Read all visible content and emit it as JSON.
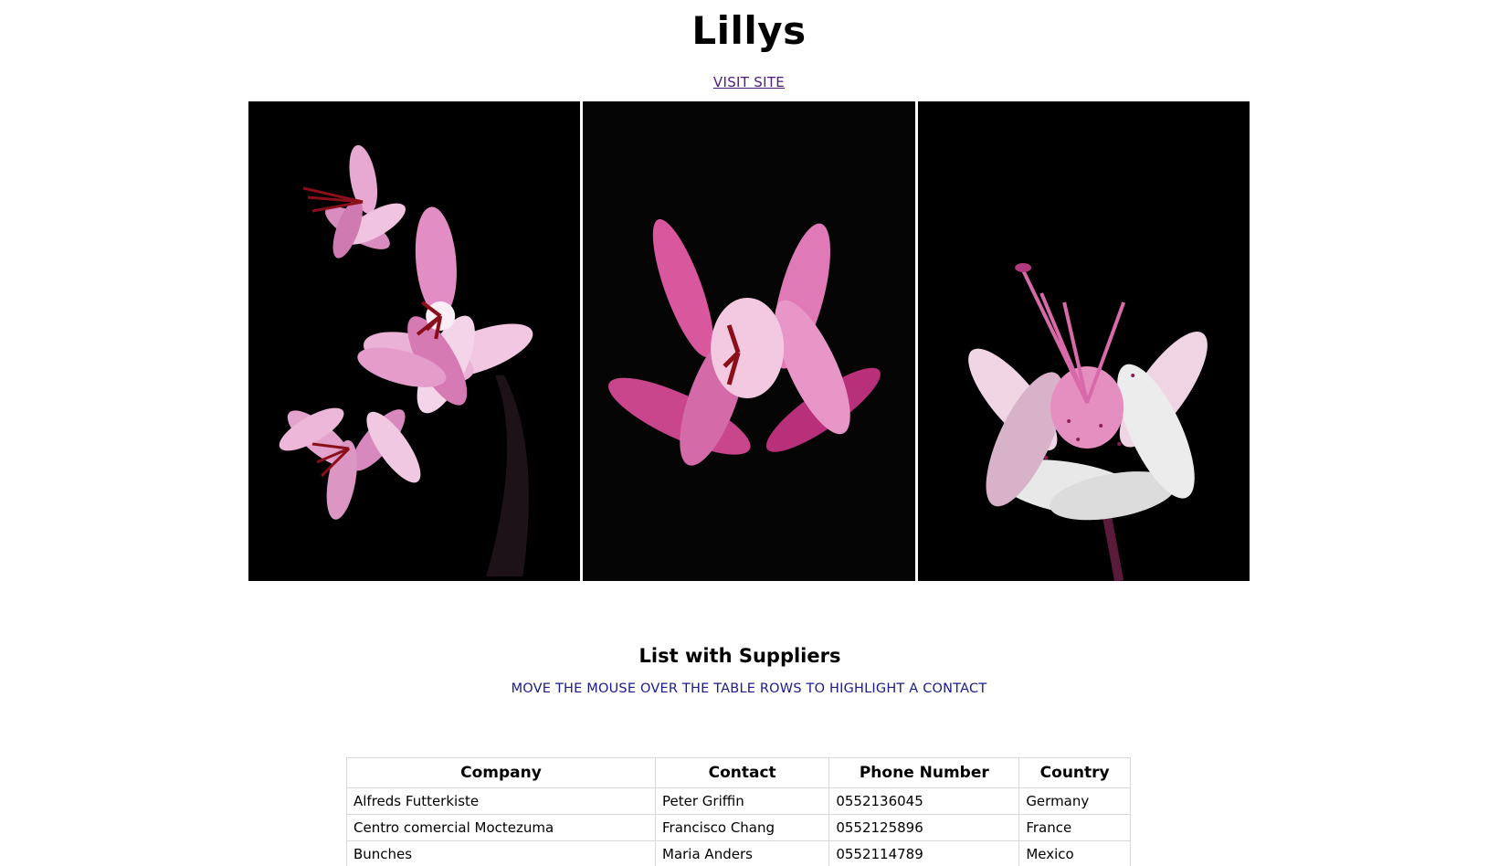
{
  "header": {
    "title": "Lillys",
    "link_label": "VISIT SITE"
  },
  "gallery": {
    "images": [
      {
        "subject": "pink-lilies-cluster"
      },
      {
        "subject": "pink-lily-side"
      },
      {
        "subject": "white-pink-lily-illustration"
      }
    ],
    "colors": {
      "background": "#000000",
      "petal": "#e28ec4",
      "petal_dark": "#c0337f",
      "stamen": "#8a0f1a"
    }
  },
  "suppliers": {
    "title": "List with Suppliers",
    "hint": "MOVE THE MOUSE OVER THE TABLE ROWS TO HIGHLIGHT A CONTACT",
    "columns": [
      "Company",
      "Contact",
      "Phone Number",
      "Country"
    ],
    "rows": [
      [
        "Alfreds Futterkiste",
        "Peter Griffin",
        "0552136045",
        "Germany"
      ],
      [
        "Centro comercial Moctezuma",
        "Francisco Chang",
        "0552125896",
        "France"
      ],
      [
        "Bunches",
        "Maria Anders",
        "0552114789",
        "Mexico"
      ]
    ]
  },
  "colors": {
    "link": "#4b1c7a",
    "hint": "#1a1a8c",
    "table_border": "#d8d8d8"
  }
}
